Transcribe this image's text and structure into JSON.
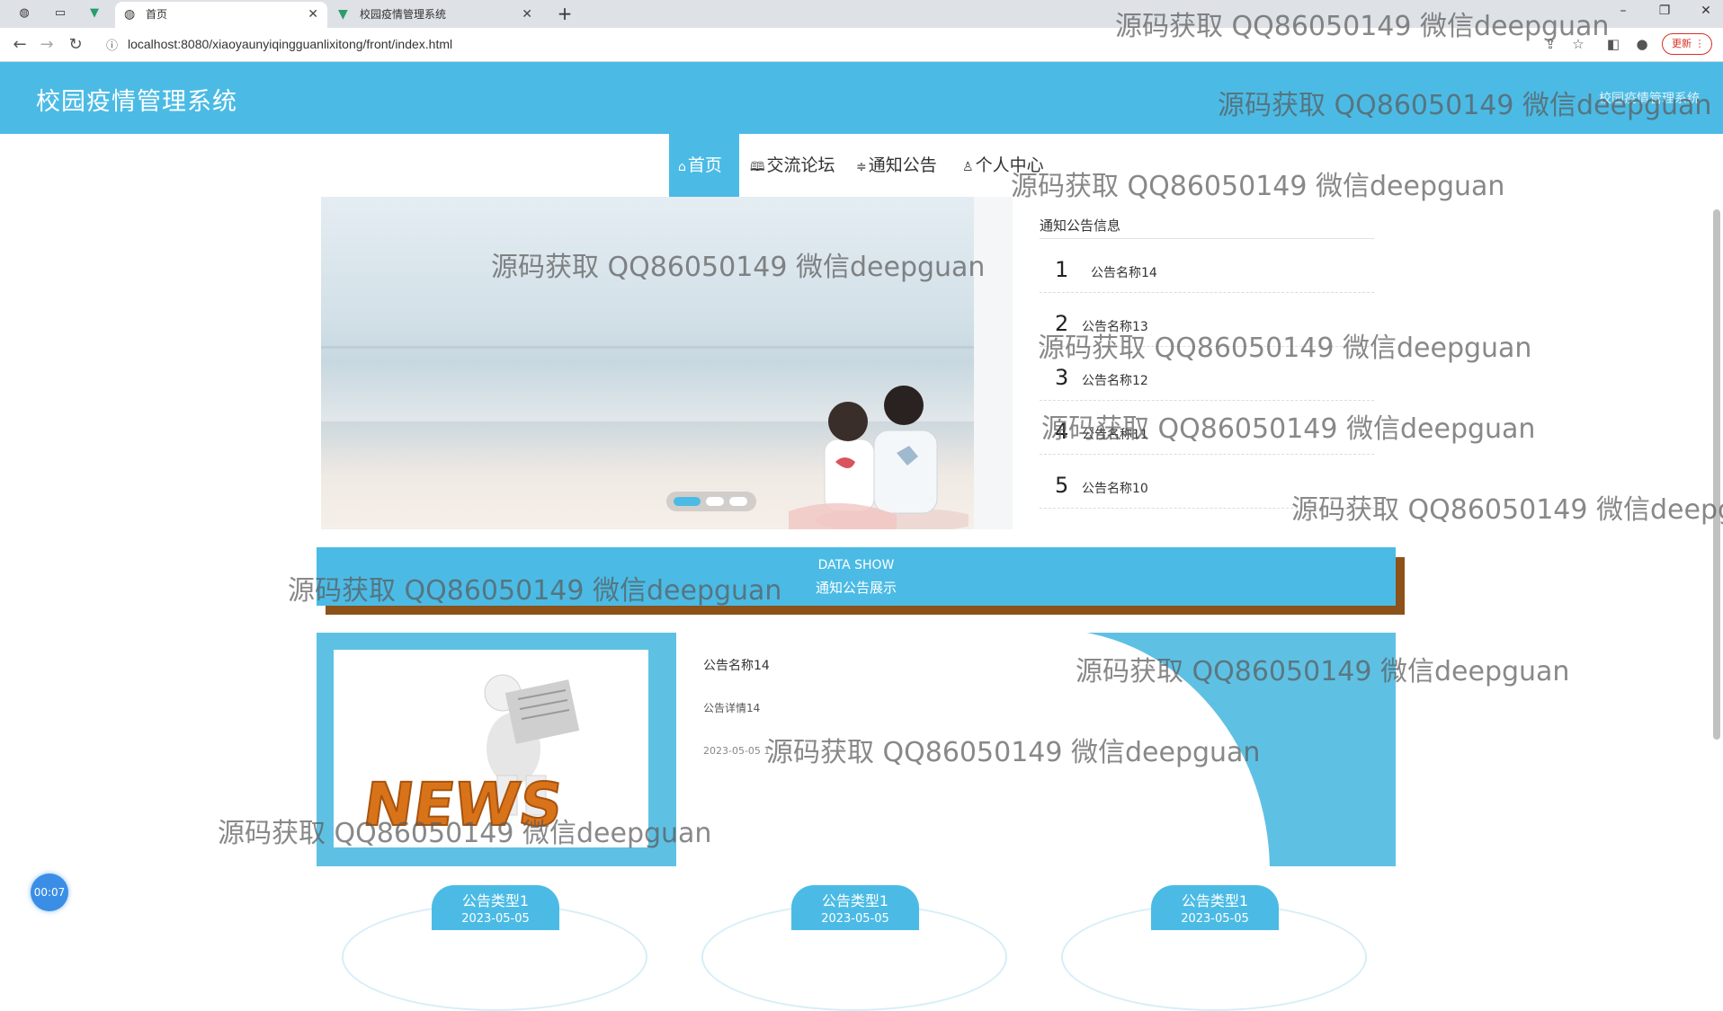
{
  "browser": {
    "tabs": [
      {
        "title": "首页",
        "active": true
      },
      {
        "title": "校园疫情管理系统",
        "active": false
      }
    ],
    "url": "localhost:8080/xiaoyaunyiqingguanlixitong/front/index.html",
    "update_label": "更新"
  },
  "site": {
    "title": "校园疫情管理系统",
    "header_right": "校园疫情管理系统"
  },
  "nav": {
    "items": [
      {
        "label": "首页",
        "icon": "home-icon"
      },
      {
        "label": "交流论坛",
        "icon": "book-icon"
      },
      {
        "label": "通知公告",
        "icon": "list-icon"
      },
      {
        "label": "个人中心",
        "icon": "user-icon"
      }
    ]
  },
  "notice_panel": {
    "heading": "通知公告信息",
    "items": [
      {
        "num": "1",
        "title": "公告名称14"
      },
      {
        "num": "2",
        "title": "公告名称13"
      },
      {
        "num": "3",
        "title": "公告名称12"
      },
      {
        "num": "4",
        "title": "公告名称11"
      },
      {
        "num": "5",
        "title": "公告名称10"
      }
    ]
  },
  "data_show": {
    "en": "DATA SHOW",
    "cn": "通知公告展示"
  },
  "featured": {
    "title": "公告名称14",
    "detail": "公告详情14",
    "date": "2023-05-05 1",
    "image_text": "NEWS"
  },
  "cards": [
    {
      "type": "公告类型1",
      "date": "2023-05-05"
    },
    {
      "type": "公告类型1",
      "date": "2023-05-05"
    },
    {
      "type": "公告类型1",
      "date": "2023-05-05"
    }
  ],
  "timer": "00:07",
  "watermark": "源码获取 QQ86050149 微信deepguan",
  "colors": {
    "primary": "#4bbbe5",
    "shadow": "#8c5219"
  }
}
